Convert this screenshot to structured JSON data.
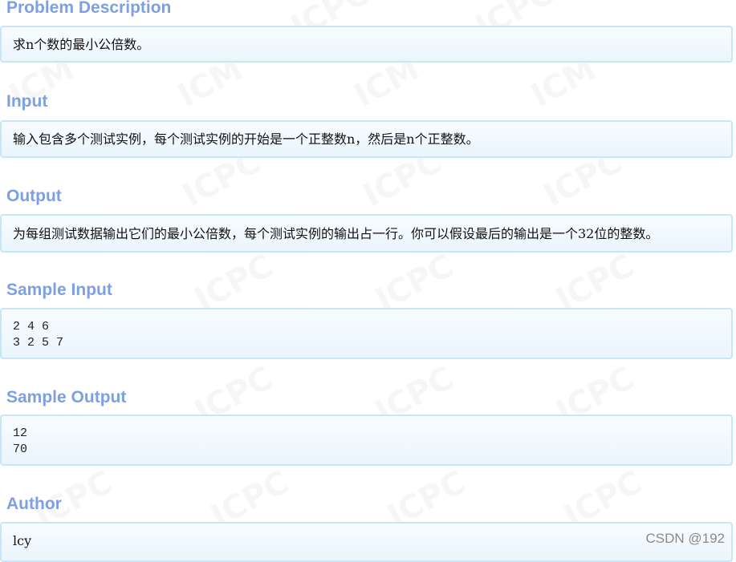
{
  "sections": {
    "problem_description": {
      "title": "Problem Description",
      "content": "求n个数的最小公倍数。"
    },
    "input": {
      "title": "Input",
      "content": "输入包含多个测试实例，每个测试实例的开始是一个正整数n，然后是n个正整数。"
    },
    "output": {
      "title": "Output",
      "content": "为每组测试数据输出它们的最小公倍数，每个测试实例的输出占一行。你可以假设最后的输出是一个32位的整数。"
    },
    "sample_input": {
      "title": "Sample Input",
      "lines": [
        "2 4 6",
        "3 2 5 7"
      ]
    },
    "sample_output": {
      "title": "Sample Output",
      "lines": [
        "12",
        "70"
      ]
    },
    "author": {
      "title": "Author",
      "content": "lcy"
    }
  },
  "watermark": {
    "csdn": "CSDN @‎192",
    "background_text": "ICPC",
    "background_text_alt": "ICM"
  }
}
